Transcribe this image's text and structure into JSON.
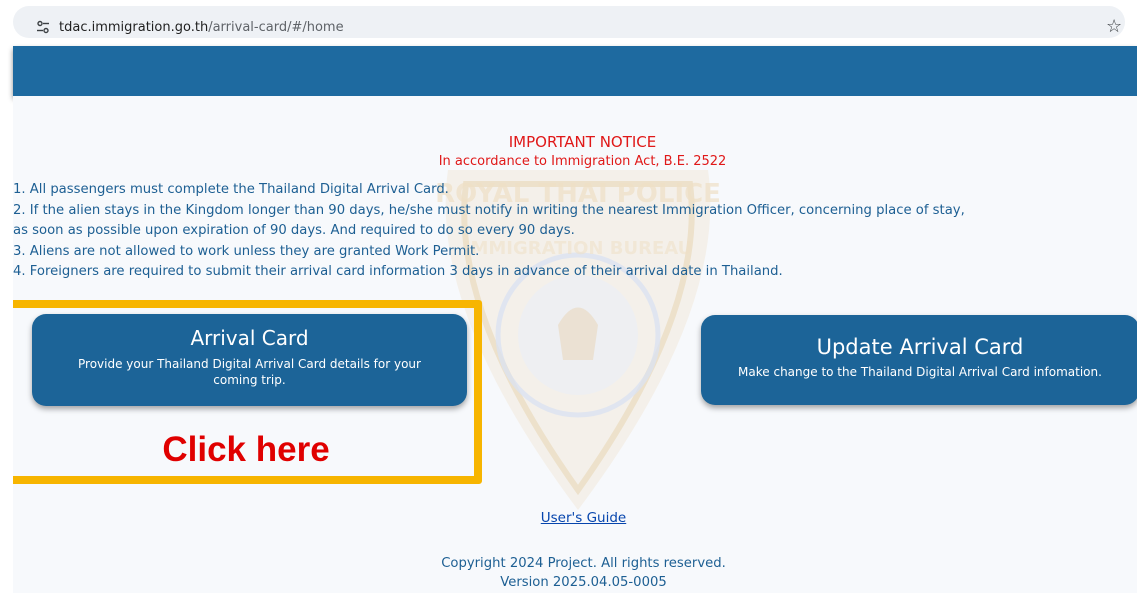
{
  "browser": {
    "url_domain": "tdac.immigration.go.th",
    "url_path": "/arrival-card/#/home"
  },
  "notice": {
    "title": "IMPORTANT NOTICE",
    "subtitle": "In accordance to Immigration Act, B.E. 2522",
    "rules": [
      "1. All passengers must complete the Thailand Digital Arrival Card.",
      "2. If the alien stays in the Kingdom longer than 90 days, he/she must notify in writing the nearest Immigration Officer, concerning place of stay,",
      "as soon as possible upon expiration of 90 days. And required to do so every 90 days.",
      "3. Aliens are not allowed to work unless they are granted Work Permit.",
      "4. Foreigners are required to submit their arrival card information 3 days in advance of their arrival date in Thailand."
    ]
  },
  "arrival_card": {
    "title": "Arrival Card",
    "description": "Provide your Thailand Digital Arrival Card details for your coming trip."
  },
  "update_card": {
    "title": "Update Arrival Card",
    "description": "Make change to the Thailand Digital Arrival Card infomation."
  },
  "annotation": {
    "click_label": "Click here",
    "highlight_color": "#f7b500"
  },
  "footer": {
    "guide_link": "User's Guide",
    "copyright": "Copyright 2024 Project. All rights reserved.",
    "version": "Version 2025.04.05-0005"
  },
  "watermark": {
    "text_top": "ROYAL THAI POLICE",
    "text_mid": "IMMIGRATION BUREAU"
  },
  "colors": {
    "header_blue": "#1e6aa0",
    "button_blue": "#1c6498",
    "notice_red": "#e01818",
    "text_blue": "#1d5f93"
  }
}
